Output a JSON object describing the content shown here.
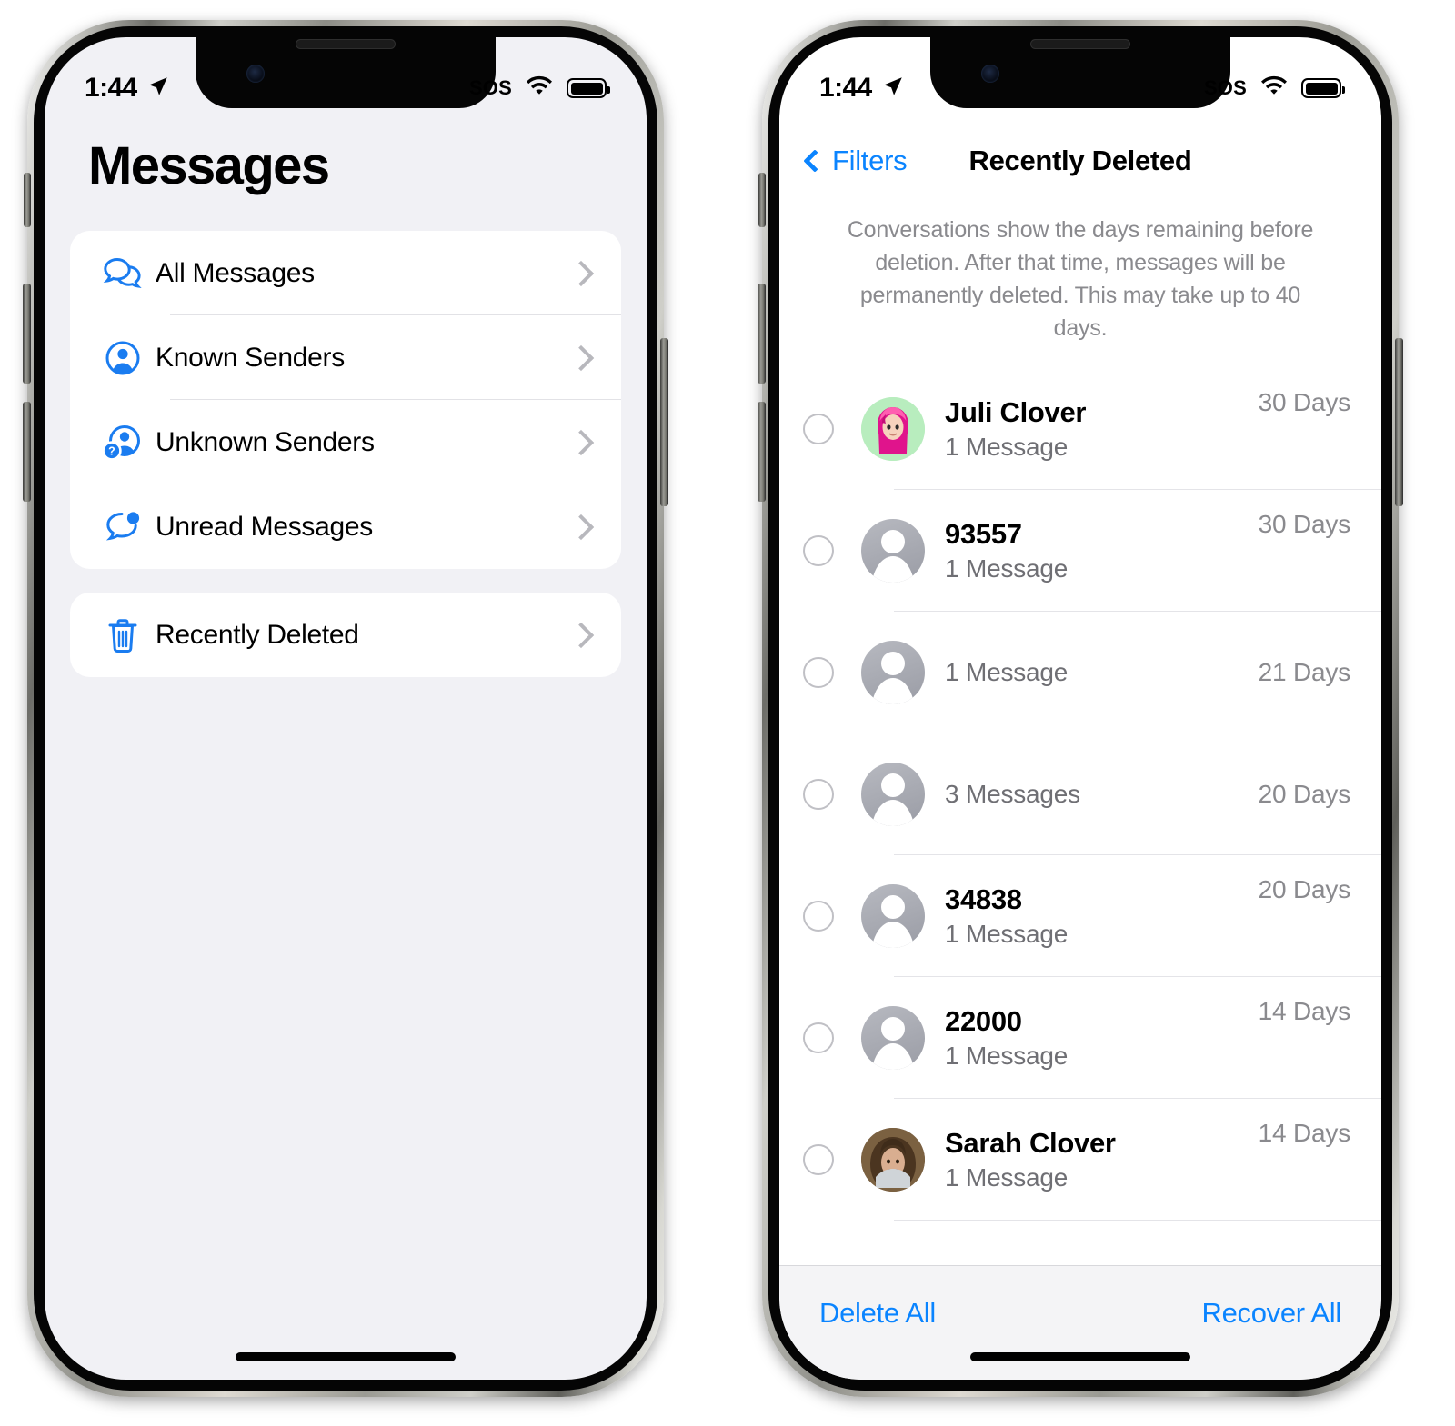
{
  "status_bar": {
    "time": "1:44",
    "location_icon": "location-arrow-icon",
    "sos_label": "SOS",
    "wifi_icon": "wifi-icon",
    "battery_icon": "battery-full-icon"
  },
  "left_phone": {
    "page_title": "Messages",
    "filter_groups": [
      {
        "items": [
          {
            "label": "All Messages",
            "icon": "chat-bubbles-icon"
          },
          {
            "label": "Known Senders",
            "icon": "person-circle-icon"
          },
          {
            "label": "Unknown Senders",
            "icon": "person-question-icon"
          },
          {
            "label": "Unread Messages",
            "icon": "unread-bubble-icon"
          }
        ]
      },
      {
        "items": [
          {
            "label": "Recently Deleted",
            "icon": "trash-icon"
          }
        ]
      }
    ],
    "disclosure_icon": "chevron-right-icon"
  },
  "right_phone": {
    "nav": {
      "back_label": "Filters",
      "back_icon": "chevron-left-icon",
      "title": "Recently Deleted"
    },
    "description": "Conversations show the days remaining before deletion. After that time, messages will be permanently deleted. This may take up to 40 days.",
    "conversations": [
      {
        "name": "Juli Clover",
        "messages": "1 Message",
        "days": "30 Days",
        "avatar": "memoji",
        "selected": false
      },
      {
        "name": "93557",
        "messages": "1 Message",
        "days": "30 Days",
        "avatar": "placeholder",
        "selected": false
      },
      {
        "name": "",
        "messages": "1 Message",
        "days": "21 Days",
        "avatar": "placeholder",
        "selected": false
      },
      {
        "name": "",
        "messages": "3 Messages",
        "days": "20 Days",
        "avatar": "placeholder",
        "selected": false
      },
      {
        "name": "34838",
        "messages": "1 Message",
        "days": "20 Days",
        "avatar": "placeholder",
        "selected": false
      },
      {
        "name": "22000",
        "messages": "1 Message",
        "days": "14 Days",
        "avatar": "placeholder",
        "selected": false
      },
      {
        "name": "Sarah Clover",
        "messages": "1 Message",
        "days": "14 Days",
        "avatar": "photo",
        "selected": false
      }
    ],
    "toolbar": {
      "delete_all_label": "Delete All",
      "recover_all_label": "Recover All"
    }
  },
  "colors": {
    "accent_blue": "#0a84ff",
    "icon_blue": "#1a7cf0",
    "screen_gray": "#f1f1f5",
    "separator": "#e2e2e6",
    "secondary_text": "#8a8a8e"
  }
}
